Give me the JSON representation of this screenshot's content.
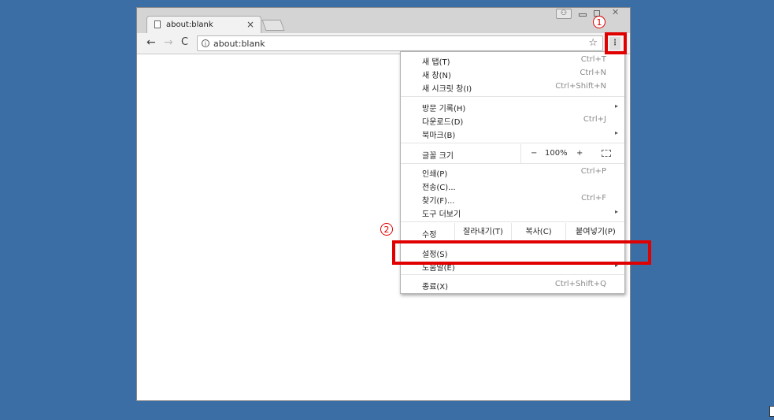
{
  "tab": {
    "title": "about:blank",
    "close": "×"
  },
  "window_controls": {
    "user": "⚇",
    "close": "✕"
  },
  "toolbar": {
    "back": "←",
    "forward": "→",
    "reload": "C",
    "url": "about:blank",
    "info": "i",
    "star": "☆",
    "menu": "⋮"
  },
  "menu": {
    "items": [
      {
        "label": "새 탭(T)",
        "shortcut": "Ctrl+T"
      },
      {
        "label": "새 창(N)",
        "shortcut": "Ctrl+N"
      },
      {
        "label": "새 시크릿 창(I)",
        "shortcut": "Ctrl+Shift+N"
      },
      {
        "label": "방문 기록(H)",
        "shortcut": ""
      },
      {
        "label": "다운로드(D)",
        "shortcut": "Ctrl+J"
      },
      {
        "label": "북마크(B)",
        "shortcut": ""
      },
      {
        "label": "인쇄(P)",
        "shortcut": "Ctrl+P"
      },
      {
        "label": "전송(C)...",
        "shortcut": ""
      },
      {
        "label": "찾기(F)...",
        "shortcut": "Ctrl+F"
      },
      {
        "label": "도구 더보기",
        "shortcut": ""
      },
      {
        "label": "설정(S)",
        "shortcut": ""
      },
      {
        "label": "도움말(E)",
        "shortcut": ""
      },
      {
        "label": "종료(X)",
        "shortcut": "Ctrl+Shift+Q"
      }
    ],
    "zoom": {
      "label": "글꼴 크기",
      "minus": "−",
      "value": "100%",
      "plus": "+"
    },
    "edit": {
      "label": "수정",
      "cut": "잘라내기(T)",
      "copy": "복사(C)",
      "paste": "붙여넣기(P)"
    },
    "arrow": "▸"
  },
  "annotations": {
    "one": "1",
    "two": "2"
  },
  "colors": {
    "desktop": "#3a6ea5",
    "highlight": "#e00000"
  }
}
